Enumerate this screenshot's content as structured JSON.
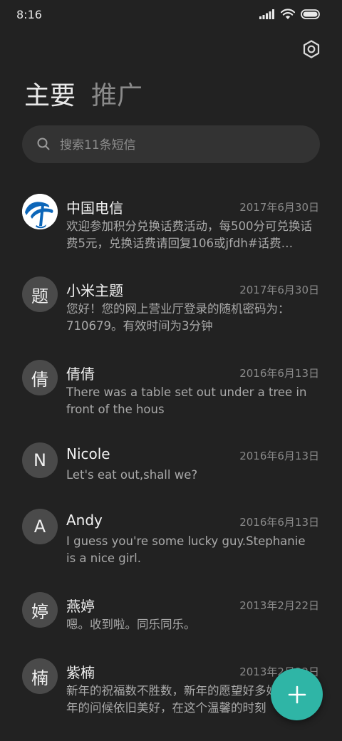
{
  "status_bar": {
    "time": "8:16"
  },
  "tabs": [
    {
      "label": "主要",
      "active": true
    },
    {
      "label": "推广",
      "active": false
    }
  ],
  "search": {
    "placeholder": "搜索11条短信",
    "value": ""
  },
  "messages": [
    {
      "sender": "中国电信",
      "date": "2017年6月30日",
      "avatar_text": "",
      "avatar_icon": "china-telecom-logo",
      "preview": "欢迎参加积分兑换话费活动，每500分可兑换话费5元，兑换话费请回复106或jfdh#话费…"
    },
    {
      "sender": "小米主题",
      "date": "2017年6月30日",
      "avatar_text": "题",
      "preview": "您好！您的网上营业厅登录的随机密码为：710679。有效时间为3分钟"
    },
    {
      "sender": "倩倩",
      "date": "2016年6月13日",
      "avatar_text": "倩",
      "preview": "There was a table set out under a tree in front of the hous"
    },
    {
      "sender": "Nicole",
      "date": "2016年6月13日",
      "avatar_text": "N",
      "preview": "Let's eat out,shall we?"
    },
    {
      "sender": "Andy",
      "date": "2016年6月13日",
      "avatar_text": "A",
      "preview": "I guess you're some lucky guy.Stephanie is a nice girl."
    },
    {
      "sender": "燕婷",
      "date": "2013年2月22日",
      "avatar_text": "婷",
      "preview": "嗯。收到啦。同乐同乐。"
    },
    {
      "sender": "紫楠",
      "date": "2013年2月22日",
      "avatar_text": "楠",
      "preview": "新年的祝福数不胜数，新年的愿望好多好多，新年的问候依旧美好，在这个温馨的时刻"
    }
  ],
  "icons": {
    "settings": "settings-icon",
    "search": "search-icon",
    "compose": "plus-icon"
  },
  "colors": {
    "background": "#222222",
    "accent": "#2fb5a6",
    "search_bg": "#333333",
    "avatar_bg": "#4a4a4a"
  }
}
